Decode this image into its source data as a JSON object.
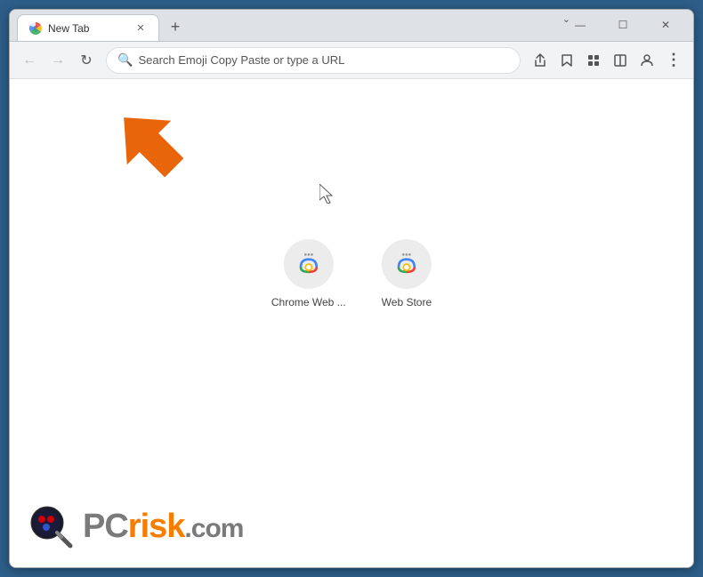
{
  "window": {
    "title": "New Tab",
    "controls": {
      "minimize": "—",
      "maximize": "☐",
      "close": "✕",
      "chevron": "⌄"
    }
  },
  "tab": {
    "label": "New Tab",
    "close_label": "✕"
  },
  "new_tab_btn": "+",
  "navbar": {
    "back_icon": "←",
    "forward_icon": "→",
    "reload_icon": "↻",
    "search_placeholder": "Search Emoji Copy Paste or type a URL",
    "share_icon": "⬆",
    "bookmark_icon": "☆",
    "extensions_icon": "⬛",
    "split_icon": "▣",
    "profile_icon": "👤",
    "menu_icon": "⋮"
  },
  "shortcuts": [
    {
      "label": "Chrome Web ...",
      "type": "chrome"
    },
    {
      "label": "Web Store",
      "type": "chrome"
    }
  ],
  "brand": {
    "pc_text": "PC",
    "risk_text": "risk",
    "dotcom_text": ".com"
  },
  "cursor_symbol": "↖"
}
